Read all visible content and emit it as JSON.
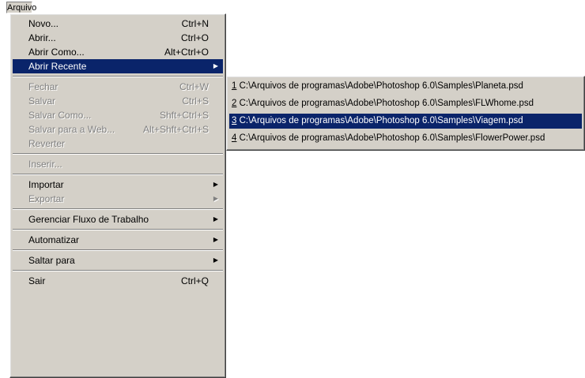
{
  "menubar": {
    "file": "Arquivo"
  },
  "menu": [
    {
      "type": "item",
      "label": "Novo...",
      "shortcut": "Ctrl+N",
      "name": "menu-item-novo"
    },
    {
      "type": "item",
      "label": "Abrir...",
      "shortcut": "Ctrl+O",
      "name": "menu-item-abrir"
    },
    {
      "type": "item",
      "label": "Abrir Como...",
      "shortcut": "Alt+Ctrl+O",
      "name": "menu-item-abrir-como"
    },
    {
      "type": "item",
      "label": "Abrir Recente",
      "submenu": true,
      "selected": true,
      "name": "menu-item-abrir-recente"
    },
    {
      "type": "sep"
    },
    {
      "type": "item",
      "label": "Fechar",
      "shortcut": "Ctrl+W",
      "disabled": true,
      "name": "menu-item-fechar"
    },
    {
      "type": "item",
      "label": "Salvar",
      "shortcut": "Ctrl+S",
      "disabled": true,
      "name": "menu-item-salvar"
    },
    {
      "type": "item",
      "label": "Salvar Como...",
      "shortcut": "Shft+Ctrl+S",
      "disabled": true,
      "name": "menu-item-salvar-como"
    },
    {
      "type": "item",
      "label": "Salvar para a Web...",
      "shortcut": "Alt+Shft+Ctrl+S",
      "disabled": true,
      "name": "menu-item-salvar-web"
    },
    {
      "type": "item",
      "label": "Reverter",
      "disabled": true,
      "name": "menu-item-reverter"
    },
    {
      "type": "sep"
    },
    {
      "type": "item",
      "label": "Inserir...",
      "disabled": true,
      "name": "menu-item-inserir"
    },
    {
      "type": "sep"
    },
    {
      "type": "item",
      "label": "Importar",
      "submenu": true,
      "name": "menu-item-importar"
    },
    {
      "type": "item",
      "label": "Exportar",
      "submenu": true,
      "disabled": true,
      "name": "menu-item-exportar"
    },
    {
      "type": "sep"
    },
    {
      "type": "item",
      "label": "Gerenciar Fluxo de Trabalho",
      "submenu": true,
      "name": "menu-item-gerenciar-fluxo"
    },
    {
      "type": "sep"
    },
    {
      "type": "item",
      "label": "Automatizar",
      "submenu": true,
      "name": "menu-item-automatizar"
    },
    {
      "type": "sep"
    },
    {
      "type": "item",
      "label": "Saltar para",
      "submenu": true,
      "name": "menu-item-saltar-para"
    },
    {
      "type": "sep"
    },
    {
      "type": "item",
      "label": "Sair",
      "shortcut": "Ctrl+Q",
      "name": "menu-item-sair"
    }
  ],
  "recent_files": [
    {
      "num": "1",
      "path": " C:\\Arquivos de programas\\Adobe\\Photoshop 6.0\\Samples\\Planeta.psd"
    },
    {
      "num": "2",
      "path": " C:\\Arquivos de programas\\Adobe\\Photoshop 6.0\\Samples\\FLWhome.psd"
    },
    {
      "num": "3",
      "path": " C:\\Arquivos de programas\\Adobe\\Photoshop 6.0\\Samples\\Viagem.psd",
      "selected": true
    },
    {
      "num": "4",
      "path": " C:\\Arquivos de programas\\Adobe\\Photoshop 6.0\\Samples\\FlowerPower.psd"
    }
  ],
  "arrow_glyph": "▶"
}
